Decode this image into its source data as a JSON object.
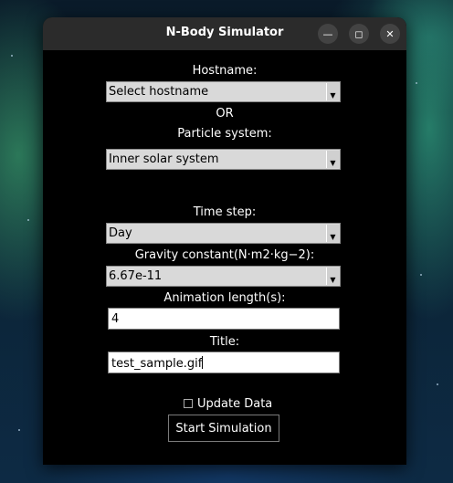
{
  "window": {
    "title": "N-Body Simulator",
    "minimize_icon": "minimize-icon",
    "maximize_icon": "maximize-icon",
    "close_icon": "close-icon"
  },
  "form": {
    "hostname_label": "Hostname:",
    "hostname_value": "Select hostname",
    "or_label": "OR",
    "particle_label": "Particle system:",
    "particle_value": "Inner solar system",
    "timestep_label": "Time step:",
    "timestep_value": "Day",
    "gravity_label": "Gravity constant(N·m2·kg−2):",
    "gravity_value": "6.67e-11",
    "animation_label": "Animation length(s):",
    "animation_value": "4",
    "title_label": "Title:",
    "title_value": "test_sample.gif",
    "update_label": "Update Data",
    "update_checked": false,
    "start_label": "Start Simulation"
  }
}
